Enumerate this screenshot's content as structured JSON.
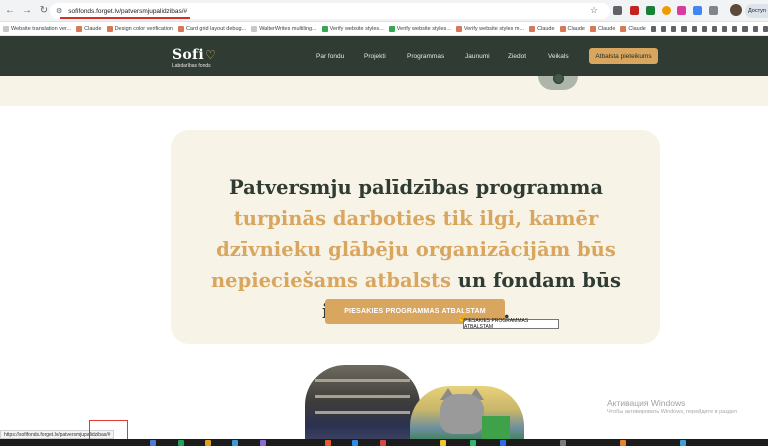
{
  "browser": {
    "url": "sofifonds.forget.lv/patversmjupalidzibas/#",
    "profile_button_label": "Доступ",
    "bookmarks": [
      {
        "label": "Website translation ver...",
        "icon": "default"
      },
      {
        "label": "Claude",
        "icon": "claude"
      },
      {
        "label": "Design color verification",
        "icon": "claude"
      },
      {
        "label": "Card grid layout debug...",
        "icon": "claude"
      },
      {
        "label": "WalterWrites multiling...",
        "icon": "default"
      },
      {
        "label": "Verify website styles...",
        "icon": "check"
      },
      {
        "label": "Verify website styles...",
        "icon": "check"
      },
      {
        "label": "Verify website styles m...",
        "icon": "claude"
      },
      {
        "label": "Claude",
        "icon": "claude"
      },
      {
        "label": "Claude",
        "icon": "claude"
      },
      {
        "label": "Claude",
        "icon": "claude"
      },
      {
        "label": "Claude",
        "icon": "claude"
      }
    ]
  },
  "site": {
    "logo_name": "Sofi",
    "logo_subtitle": "Labdarības fonds",
    "nav": [
      "Par fondu",
      "Projekti",
      "Programmas",
      "Jaunumi",
      "Ziedot",
      "Veikals"
    ],
    "cta_label": "Atbalsta pieteikums"
  },
  "hero": {
    "heading_dark_1": "Patversmju palīdzības programma ",
    "heading_accent": "turpinās darboties tik ilgi, kamēr dzīvnieku glābēju organizācijām būs nepieciešams atbalsts",
    "heading_dark_2": " un fondam būs iespējas palīdzēt.",
    "button_label": "PIESAKIES PROGRAMMAS ATBALSTAM",
    "tooltip": "PIESAKIES PROGRAMMAS ATBALSTAM"
  },
  "windows": {
    "watermark_title": "Активация Windows",
    "watermark_subtitle": "Чтобы активировать Windows, перейдите в раздел"
  },
  "status_bar": {
    "url": "https://sofifonds.forget.lv/patversmjupalidzibas/#"
  },
  "colors": {
    "header_bg": "#2f3b33",
    "accent": "#d9a660",
    "card_bg": "#f7f3e6"
  }
}
